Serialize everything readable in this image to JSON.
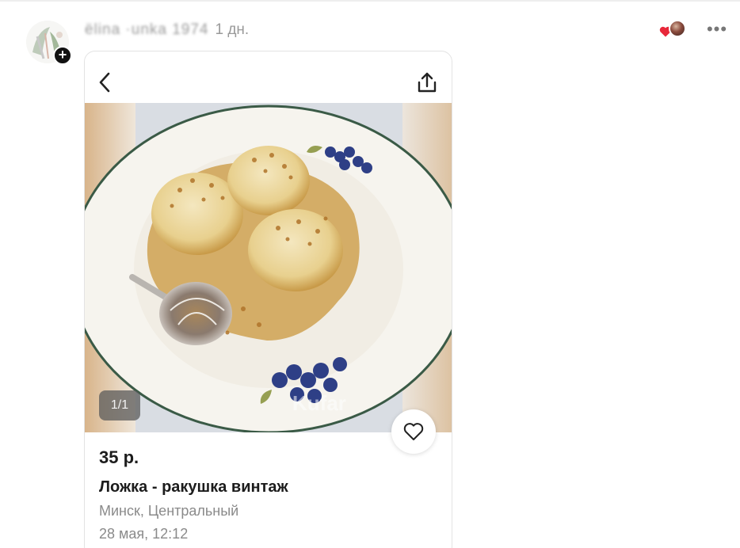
{
  "post": {
    "author_name": "ëlina ·unka 1974",
    "time": "1 дн.",
    "more_label": "•••"
  },
  "listing": {
    "photo_counter": "1/1",
    "watermark": "Kufar",
    "price": "35 р.",
    "title": "Ложка - ракушка винтаж",
    "location": "Минск, Центральный",
    "date": "28 мая, 12:12"
  },
  "icons": {
    "back": "chevron-left-icon",
    "share": "share-upload-icon",
    "favorite": "heart-outline-icon",
    "reaction": "heart-filled-icon",
    "add": "plus-icon"
  },
  "colors": {
    "reaction_heart": "#e8283a",
    "text_primary": "#1c1c1c",
    "text_secondary": "#8a8a8a"
  }
}
